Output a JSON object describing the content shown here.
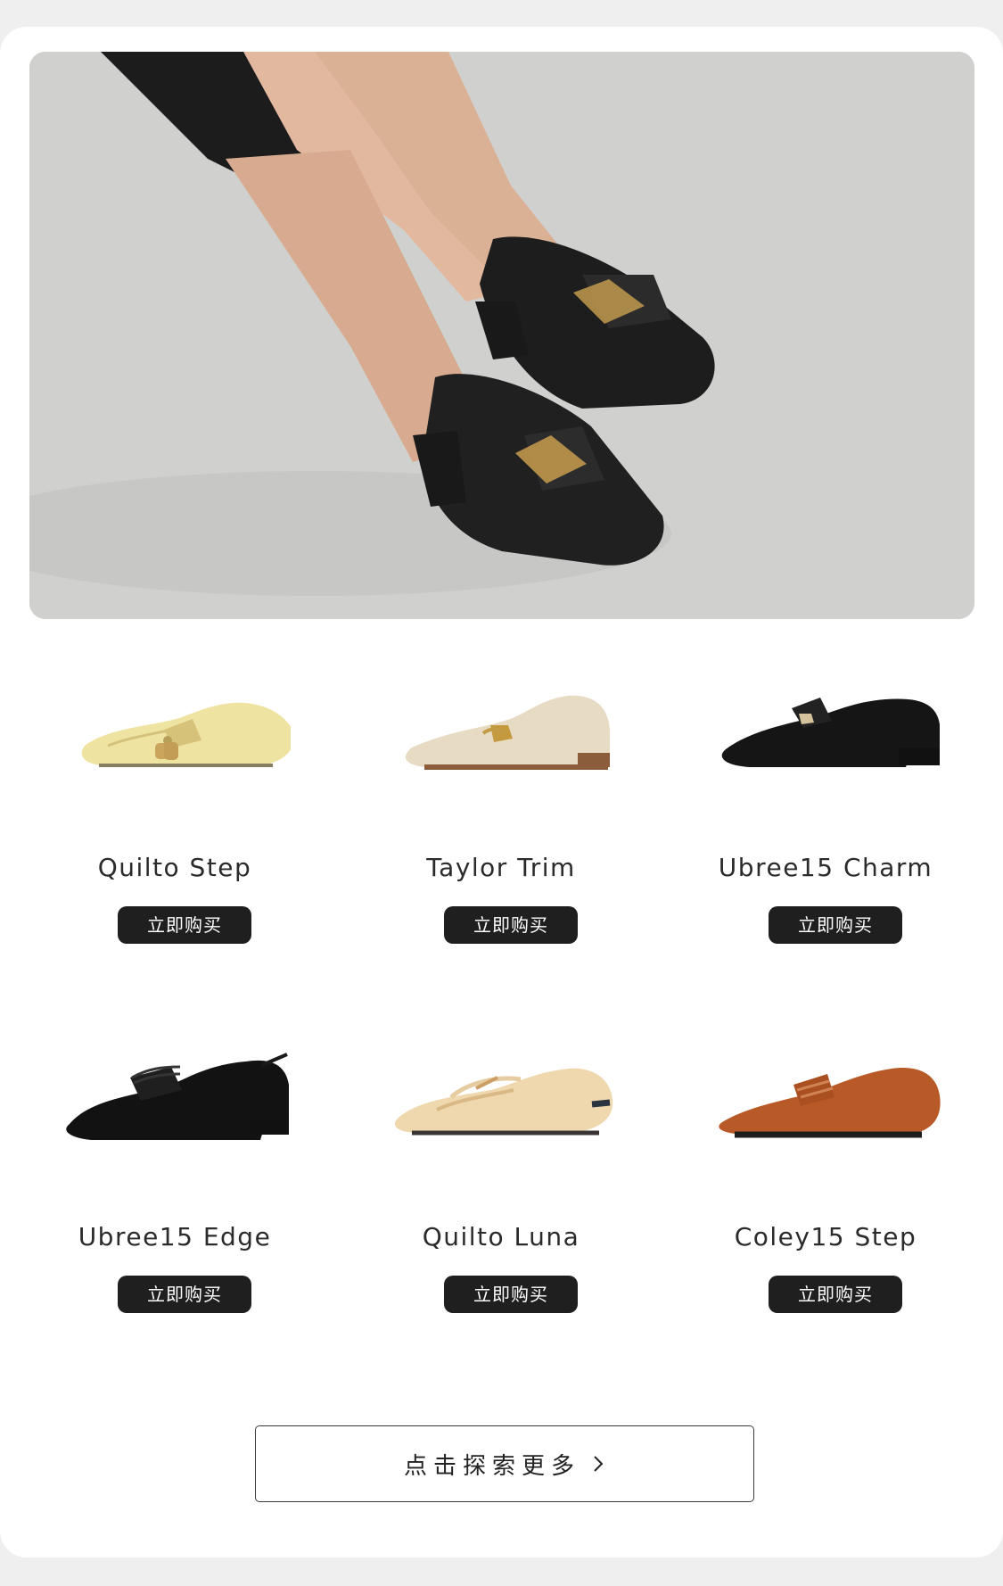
{
  "products": [
    {
      "name": "Quilto Step",
      "cta": "立即购买"
    },
    {
      "name": "Taylor Trim",
      "cta": "立即购买"
    },
    {
      "name": "Ubree15 Charm",
      "cta": "立即购买"
    },
    {
      "name": "Ubree15 Edge",
      "cta": "立即购买"
    },
    {
      "name": "Quilto Luna",
      "cta": "立即购买"
    },
    {
      "name": "Coley15 Step",
      "cta": "立即购买"
    }
  ],
  "explore": {
    "label": "点击探索更多"
  },
  "icons": {
    "explore_arrow": "chevron-right-icon"
  },
  "colors": {
    "button_bg": "#1f1f1f",
    "button_text": "#ffffff",
    "page_bg": "#efefef",
    "card_bg": "#ffffff"
  }
}
